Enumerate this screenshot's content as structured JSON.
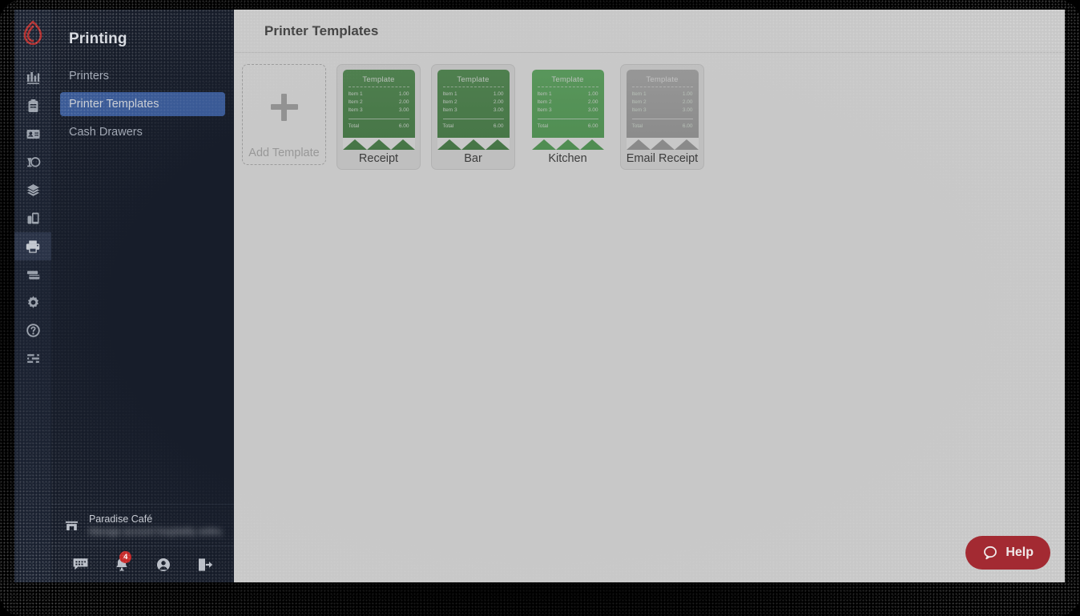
{
  "sidebar": {
    "title": "Printing",
    "nav": [
      {
        "label": "Printers",
        "active": false
      },
      {
        "label": "Printer Templates",
        "active": true
      },
      {
        "label": "Cash Drawers",
        "active": false
      }
    ],
    "rail_icons": [
      "reports-chart-icon",
      "clipboard-icon",
      "contact-card-icon",
      "wine-glass-icon",
      "layers-icon",
      "devices-icon",
      "printer-icon",
      "payment-cards-icon",
      "gear-icon",
      "help-circle-icon",
      "list-settings-icon"
    ],
    "logo": "lightspeed-flame-logo",
    "store": {
      "icon": "storefront-icon",
      "name": "Paradise Café",
      "subtitle": "Manage account hospitality settings"
    },
    "footer": [
      {
        "icon": "chat-bubble-icon",
        "badge": ""
      },
      {
        "icon": "bell-notification-icon",
        "badge": "4"
      },
      {
        "icon": "user-account-icon",
        "badge": ""
      },
      {
        "icon": "logout-icon",
        "badge": ""
      }
    ]
  },
  "main": {
    "page_title": "Printer Templates",
    "add_card": {
      "label": "Add Template",
      "icon": "plus-icon"
    },
    "receipt_preview": {
      "title": "Template",
      "items": [
        {
          "name": "Item 1",
          "price": "1.00"
        },
        {
          "name": "Item 2",
          "price": "2.00"
        },
        {
          "name": "Item 3",
          "price": "3.00"
        }
      ],
      "total": {
        "name": "Total",
        "price": "6.00"
      }
    },
    "templates": [
      {
        "label": "Receipt",
        "state": "normal"
      },
      {
        "label": "Bar",
        "state": "normal"
      },
      {
        "label": "Kitchen",
        "state": "selected"
      },
      {
        "label": "Email Receipt",
        "state": "dim"
      }
    ]
  },
  "help": {
    "label": "Help",
    "icon": "chat-bubble-icon"
  },
  "colors": {
    "rail_bg": "#1b2231",
    "sidebar_bg": "#171d2a",
    "nav_active": "#3a5a96",
    "brand_red": "#c0392b",
    "help_bg": "#a32a32",
    "receipt_green": "#3c8a3c",
    "receipt_green_selected": "#4caf50",
    "receipt_gray": "#b0b0b0",
    "badge_red": "#c62828"
  }
}
